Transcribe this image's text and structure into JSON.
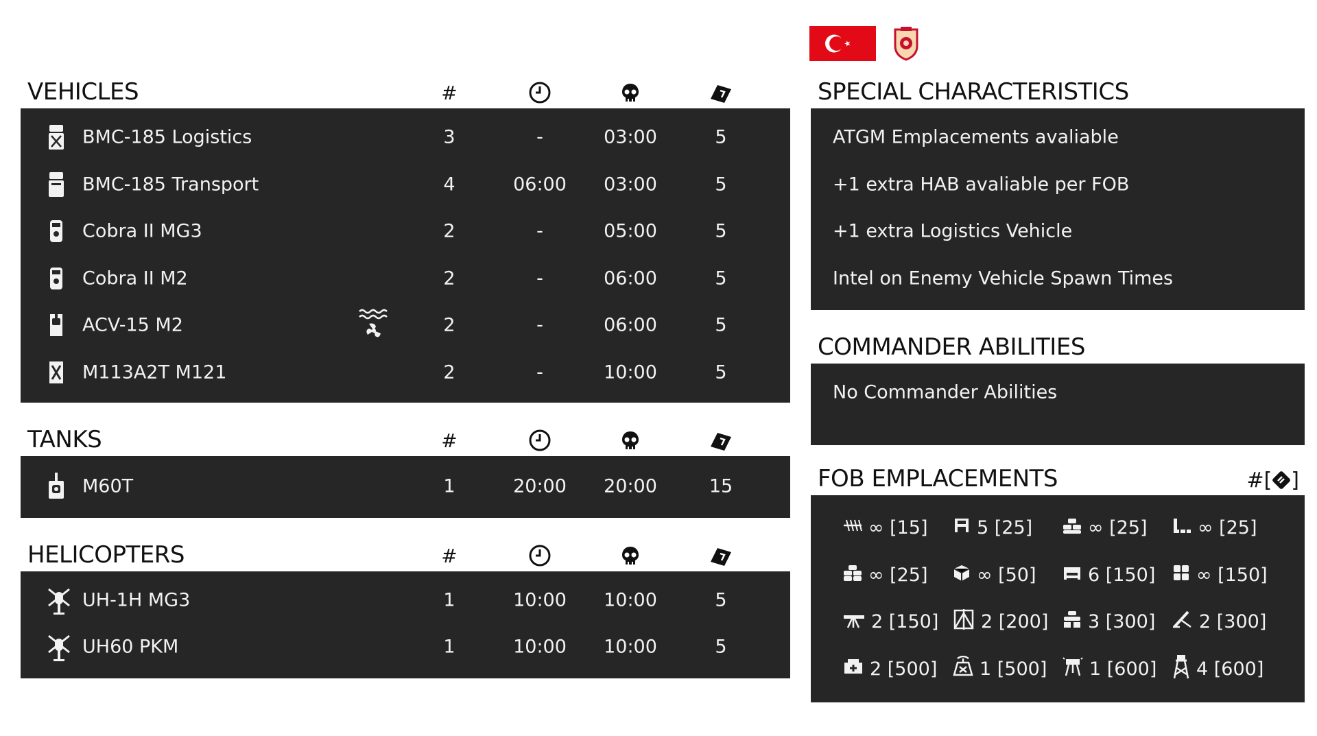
{
  "faction": {
    "flag_colors": {
      "red": "#e30a17",
      "white": "#ffffff"
    },
    "flag_icon": "turkey-flag-icon",
    "seal_icon": "turkish-army-seal-icon"
  },
  "columns": {
    "count_header": "#",
    "delay_icon": "clock-icon",
    "respawn_icon": "skull-icon",
    "tickets_icon": "ticket-icon"
  },
  "vehicles": {
    "title": "VEHICLES",
    "rows": [
      {
        "name": "BMC-185 Logistics",
        "icon": "logistics-truck-icon",
        "count": "3",
        "delay": "-",
        "respawn": "03:00",
        "tickets": "5"
      },
      {
        "name": "BMC-185 Transport",
        "icon": "transport-truck-icon",
        "count": "4",
        "delay": "06:00",
        "respawn": "03:00",
        "tickets": "5"
      },
      {
        "name": "Cobra II MG3",
        "icon": "mrap-icon",
        "count": "2",
        "delay": "-",
        "respawn": "05:00",
        "tickets": "5"
      },
      {
        "name": "Cobra II M2",
        "icon": "mrap-icon",
        "count": "2",
        "delay": "-",
        "respawn": "06:00",
        "tickets": "5"
      },
      {
        "name": "ACV-15 M2",
        "icon": "apc-icon",
        "extra_icon": "amphibious-icon",
        "count": "2",
        "delay": "-",
        "respawn": "06:00",
        "tickets": "5"
      },
      {
        "name": "M113A2T M121",
        "icon": "mortar-carrier-icon",
        "count": "2",
        "delay": "-",
        "respawn": "10:00",
        "tickets": "5"
      }
    ]
  },
  "tanks": {
    "title": "TANKS",
    "rows": [
      {
        "name": "M60T",
        "icon": "tank-icon",
        "count": "1",
        "delay": "20:00",
        "respawn": "20:00",
        "tickets": "15"
      }
    ]
  },
  "helicopters": {
    "title": "HELICOPTERS",
    "rows": [
      {
        "name": "UH-1H MG3",
        "icon": "helicopter-icon",
        "count": "1",
        "delay": "10:00",
        "respawn": "10:00",
        "tickets": "5"
      },
      {
        "name": "UH60 PKM",
        "icon": "helicopter-icon",
        "count": "1",
        "delay": "10:00",
        "respawn": "10:00",
        "tickets": "5"
      }
    ]
  },
  "special": {
    "title": "SPECIAL CHARACTERISTICS",
    "items": [
      "ATGM Emplacements avaliable",
      "+1 extra HAB avaliable per FOB",
      "+1 extra Logistics Vehicle",
      "Intel on Enemy Vehicle Spawn Times"
    ]
  },
  "commander": {
    "title": "COMMANDER ABILITIES",
    "items": [
      "No Commander Abilities"
    ]
  },
  "fob": {
    "title": "FOB EMPLACEMENTS",
    "header_text": "#[",
    "header_text_end": "]",
    "header_icon": "construction-points-icon",
    "items": [
      {
        "icon": "razorwire-icon",
        "text": "∞ [15]"
      },
      {
        "icon": "hesco-icon",
        "text": "5 [25]"
      },
      {
        "icon": "sandbag-wall-icon",
        "text": "∞ [25]"
      },
      {
        "icon": "sandbag-corner-icon",
        "text": "∞ [25]"
      },
      {
        "icon": "sandbag-stack-icon",
        "text": "∞ [25]"
      },
      {
        "icon": "ammo-crate-icon",
        "text": "∞ [50]"
      },
      {
        "icon": "bunker-icon",
        "text": "6 [150]"
      },
      {
        "icon": "sandbag-block-icon",
        "text": "∞ [150]"
      },
      {
        "icon": "hmg-icon",
        "text": "2 [150]"
      },
      {
        "icon": "atgm-icon",
        "text": "2 [200]"
      },
      {
        "icon": "fortification-icon",
        "text": "3 [300]"
      },
      {
        "icon": "mortar-icon",
        "text": "2 [300]"
      },
      {
        "icon": "repair-station-icon",
        "text": "2 [500]"
      },
      {
        "icon": "radio-icon",
        "text": "1 [500]"
      },
      {
        "icon": "aa-gun-icon",
        "text": "1 [600]"
      },
      {
        "icon": "watchtower-icon",
        "text": "4 [600]"
      }
    ]
  }
}
